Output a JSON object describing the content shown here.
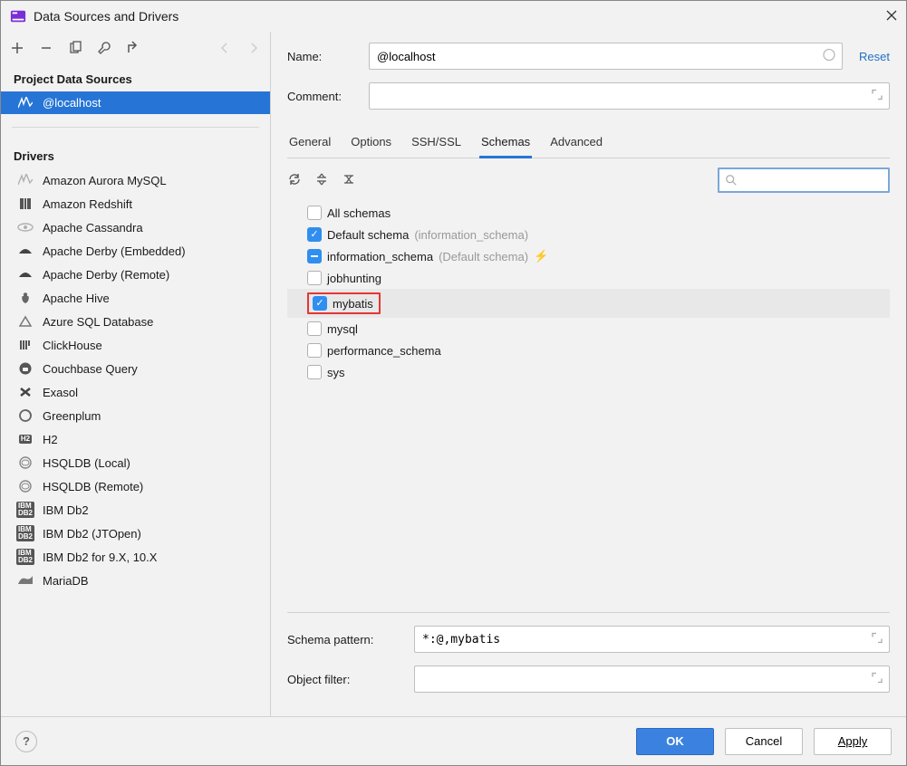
{
  "window": {
    "title": "Data Sources and Drivers"
  },
  "sidebar": {
    "projectSection": "Project Data Sources",
    "dataSources": [
      "@localhost"
    ],
    "driversSection": "Drivers",
    "drivers": [
      "Amazon Aurora MySQL",
      "Amazon Redshift",
      "Apache Cassandra",
      "Apache Derby (Embedded)",
      "Apache Derby (Remote)",
      "Apache Hive",
      "Azure SQL Database",
      "ClickHouse",
      "Couchbase Query",
      "Exasol",
      "Greenplum",
      "H2",
      "HSQLDB (Local)",
      "HSQLDB (Remote)",
      "IBM Db2",
      "IBM Db2 (JTOpen)",
      "IBM Db2 for 9.X, 10.X",
      "MariaDB"
    ]
  },
  "form": {
    "nameLabel": "Name:",
    "nameValue": "@localhost",
    "commentLabel": "Comment:",
    "commentValue": "",
    "resetLabel": "Reset"
  },
  "tabs": [
    "General",
    "Options",
    "SSH/SSL",
    "Schemas",
    "Advanced"
  ],
  "activeTab": 3,
  "schemas": [
    {
      "label": "All schemas",
      "state": "unchecked"
    },
    {
      "label": "Default schema",
      "hint": "(information_schema)",
      "state": "checked"
    },
    {
      "label": "information_schema",
      "hint": "(Default schema)",
      "state": "minus",
      "bolt": true
    },
    {
      "label": "jobhunting",
      "state": "unchecked"
    },
    {
      "label": "mybatis",
      "state": "checked",
      "selected": true,
      "highlight": true
    },
    {
      "label": "mysql",
      "state": "unchecked"
    },
    {
      "label": "performance_schema",
      "state": "unchecked"
    },
    {
      "label": "sys",
      "state": "unchecked"
    }
  ],
  "bottom": {
    "schemaPatternLabel": "Schema pattern:",
    "schemaPatternValue": "*:@,mybatis",
    "objectFilterLabel": "Object filter:",
    "objectFilterValue": ""
  },
  "footer": {
    "ok": "OK",
    "cancel": "Cancel",
    "apply": "Apply"
  }
}
